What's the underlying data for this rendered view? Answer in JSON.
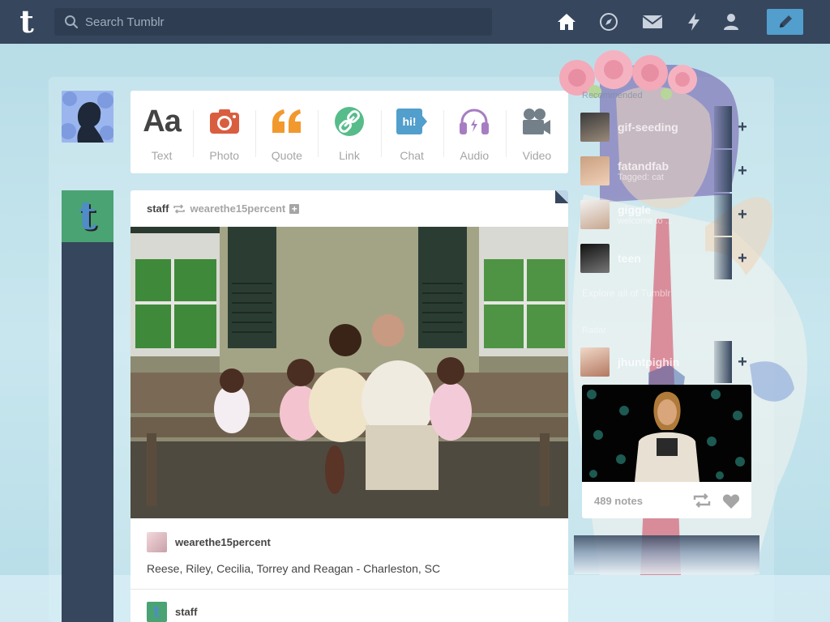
{
  "header": {
    "search_placeholder": "Search Tumblr"
  },
  "post_types": [
    {
      "label": "Text",
      "icon": "text-icon",
      "color": "#444444"
    },
    {
      "label": "Photo",
      "icon": "camera-icon",
      "color": "#d95e40"
    },
    {
      "label": "Quote",
      "icon": "quote-icon",
      "color": "#f2992e"
    },
    {
      "label": "Link",
      "icon": "link-icon",
      "color": "#56bc8a"
    },
    {
      "label": "Chat",
      "icon": "chat-icon",
      "color": "#529ecc"
    },
    {
      "label": "Audio",
      "icon": "headphones-icon",
      "color": "#a77dc2"
    },
    {
      "label": "Video",
      "icon": "video-camera-icon",
      "color": "#748089"
    }
  ],
  "post": {
    "author": "staff",
    "reblogged_from": "wearethe15percent",
    "source_name": "wearethe15percent",
    "caption": "Reese, Riley, Cecilia, Torrey and Reagan - Charleston, SC",
    "next_author": "staff"
  },
  "sidebar": {
    "recommended_label": "Recommended",
    "recommended": [
      {
        "name": "gif-seeding",
        "sub": ""
      },
      {
        "name": "fatandfab",
        "sub": "Tagged: cat"
      },
      {
        "name": "giggle",
        "sub": "welcome to ..."
      },
      {
        "name": "teen",
        "sub": ""
      }
    ],
    "explore": "Explore all of Tumblr",
    "radar_label": "Radar",
    "radar_blog": {
      "name": "jhuntpighin"
    },
    "radar_notes": "489 notes"
  },
  "colors": {
    "header_bg": "#36465d",
    "accent": "#529ecc"
  }
}
